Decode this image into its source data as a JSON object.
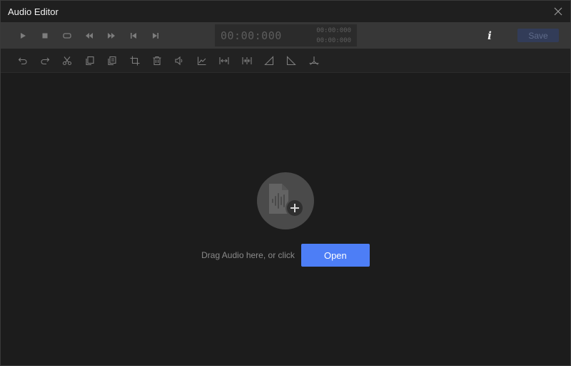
{
  "window": {
    "title": "Audio Editor"
  },
  "transport": {
    "buttons": [
      {
        "icon": "play-icon"
      },
      {
        "icon": "stop-icon"
      },
      {
        "icon": "loop-icon"
      },
      {
        "icon": "rewind-icon"
      },
      {
        "icon": "fast-forward-icon"
      },
      {
        "icon": "skip-to-start-icon"
      },
      {
        "icon": "skip-to-end-icon"
      }
    ],
    "time_main": "00:00:000",
    "time_start": "00:00:000",
    "time_end": "00:00:000",
    "info_label": "i",
    "save_label": "Save"
  },
  "edit_toolbar": {
    "buttons": [
      {
        "icon": "undo-icon"
      },
      {
        "icon": "redo-icon"
      },
      {
        "icon": "cut-icon"
      },
      {
        "icon": "copy-icon"
      },
      {
        "icon": "paste-icon"
      },
      {
        "icon": "crop-icon"
      },
      {
        "icon": "delete-icon"
      },
      {
        "icon": "volume-icon"
      },
      {
        "icon": "fade-curve-icon"
      },
      {
        "icon": "insert-silence-icon"
      },
      {
        "icon": "trim-silence-icon"
      },
      {
        "icon": "fade-in-icon"
      },
      {
        "icon": "fade-out-icon"
      },
      {
        "icon": "split-icon"
      }
    ]
  },
  "drop_zone": {
    "icon": "audio-file-add-icon",
    "text": "Drag Audio here, or click",
    "open_label": "Open"
  },
  "colors": {
    "accent": "#4d7ef6",
    "save_disabled_bg": "#323c58",
    "transport_bg": "#373737",
    "icon_color": "#7d7d7d"
  }
}
